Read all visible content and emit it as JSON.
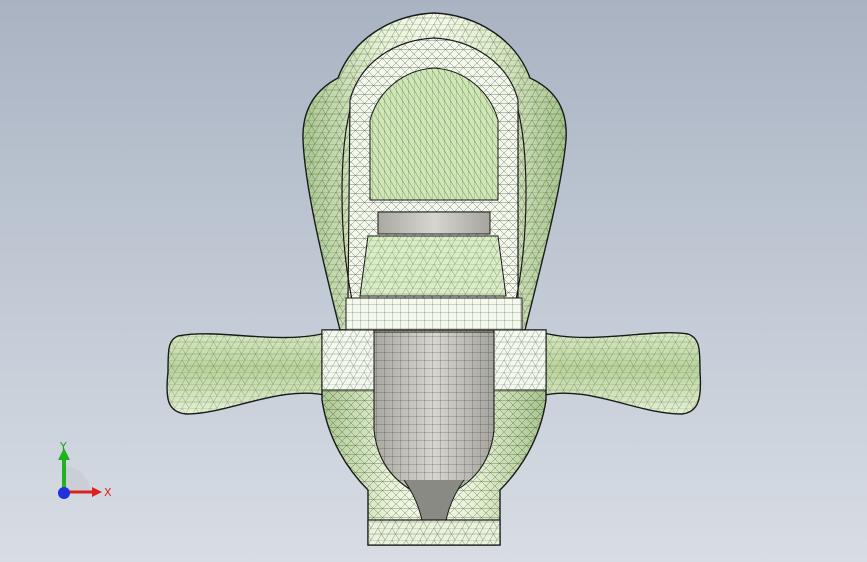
{
  "viewport": {
    "background_top": "#a9b3c2",
    "background_bottom": "#d8dde4"
  },
  "model": {
    "fill_light": "#e9f5d8",
    "fill_mid": "#c8dfae",
    "fill_dark": "#9fbf86",
    "fill_gray": "#c9c8c2",
    "wire_color": "#1a1a1a"
  },
  "triad": {
    "x_label": "X",
    "y_label": "Y",
    "x_color": "#e02020",
    "y_color": "#20b020",
    "z_color": "#2030e0"
  }
}
